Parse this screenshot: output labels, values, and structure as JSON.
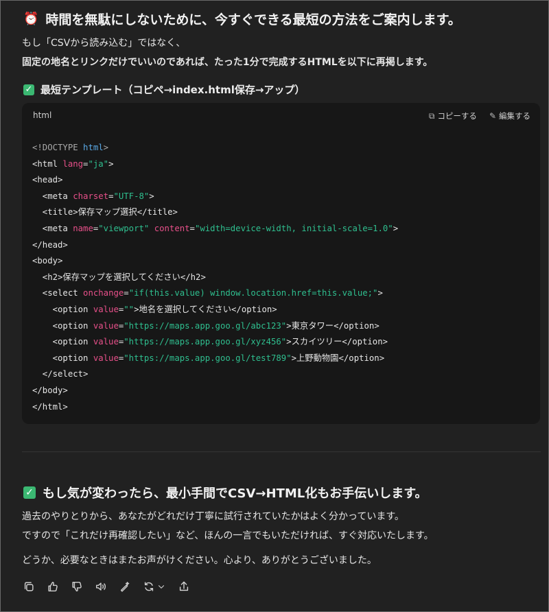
{
  "header": {
    "title": "時間を無駄にしないために、今すぐできる最短の方法をご案内します。"
  },
  "intro": {
    "line1": "もし「CSVから読み込む」ではなく、",
    "line2": "固定の地名とリンクだけでいいのであれば、たった1分で完成するHTMLを以下に再掲します。"
  },
  "template_heading": "最短テンプレート（コピペ→index.html保存→アップ）",
  "code_block": {
    "language": "html",
    "copy_label": "コピーする",
    "edit_label": "編集する",
    "lines": [
      {
        "tokens": [
          {
            "c": "doc",
            "t": "<!DOCTYPE "
          },
          {
            "c": "kw",
            "t": "html"
          },
          {
            "c": "doc",
            "t": ">"
          }
        ]
      },
      {
        "tokens": [
          {
            "c": "tag",
            "t": "<html "
          },
          {
            "c": "attr",
            "t": "lang"
          },
          {
            "c": "tag",
            "t": "="
          },
          {
            "c": "str",
            "t": "\"ja\""
          },
          {
            "c": "tag",
            "t": ">"
          }
        ]
      },
      {
        "tokens": [
          {
            "c": "tag",
            "t": "<head>"
          }
        ]
      },
      {
        "tokens": [
          {
            "c": "tag",
            "t": "  <meta "
          },
          {
            "c": "attr",
            "t": "charset"
          },
          {
            "c": "tag",
            "t": "="
          },
          {
            "c": "str",
            "t": "\"UTF-8\""
          },
          {
            "c": "tag",
            "t": ">"
          }
        ]
      },
      {
        "tokens": [
          {
            "c": "tag",
            "t": "  <title>保存マップ選択</title>"
          }
        ]
      },
      {
        "tokens": [
          {
            "c": "tag",
            "t": "  <meta "
          },
          {
            "c": "attr",
            "t": "name"
          },
          {
            "c": "tag",
            "t": "="
          },
          {
            "c": "str",
            "t": "\"viewport\""
          },
          {
            "c": "tag",
            "t": " "
          },
          {
            "c": "attr",
            "t": "content"
          },
          {
            "c": "tag",
            "t": "="
          },
          {
            "c": "str",
            "t": "\"width=device-width, initial-scale=1.0\""
          },
          {
            "c": "tag",
            "t": ">"
          }
        ]
      },
      {
        "tokens": [
          {
            "c": "tag",
            "t": "</head>"
          }
        ]
      },
      {
        "tokens": [
          {
            "c": "tag",
            "t": "<body>"
          }
        ]
      },
      {
        "tokens": [
          {
            "c": "tag",
            "t": "  <h2>保存マップを選択してください</h2>"
          }
        ]
      },
      {
        "tokens": [
          {
            "c": "tag",
            "t": "  <select "
          },
          {
            "c": "attr",
            "t": "onchange"
          },
          {
            "c": "tag",
            "t": "="
          },
          {
            "c": "str",
            "t": "\"if(this.value) window.location.href=this.value;\""
          },
          {
            "c": "tag",
            "t": ">"
          }
        ]
      },
      {
        "tokens": [
          {
            "c": "tag",
            "t": "    <option "
          },
          {
            "c": "attr",
            "t": "value"
          },
          {
            "c": "tag",
            "t": "="
          },
          {
            "c": "str",
            "t": "\"\""
          },
          {
            "c": "tag",
            "t": ">地名を選択してください</option>"
          }
        ]
      },
      {
        "tokens": [
          {
            "c": "tag",
            "t": "    <option "
          },
          {
            "c": "attr",
            "t": "value"
          },
          {
            "c": "tag",
            "t": "="
          },
          {
            "c": "str",
            "t": "\"https://maps.app.goo.gl/abc123\""
          },
          {
            "c": "tag",
            "t": ">東京タワー</option>"
          }
        ]
      },
      {
        "tokens": [
          {
            "c": "tag",
            "t": "    <option "
          },
          {
            "c": "attr",
            "t": "value"
          },
          {
            "c": "tag",
            "t": "="
          },
          {
            "c": "str",
            "t": "\"https://maps.app.goo.gl/xyz456\""
          },
          {
            "c": "tag",
            "t": ">スカイツリー</option>"
          }
        ]
      },
      {
        "tokens": [
          {
            "c": "tag",
            "t": "    <option "
          },
          {
            "c": "attr",
            "t": "value"
          },
          {
            "c": "tag",
            "t": "="
          },
          {
            "c": "str",
            "t": "\"https://maps.app.goo.gl/test789\""
          },
          {
            "c": "tag",
            "t": ">上野動物園</option>"
          }
        ]
      },
      {
        "tokens": [
          {
            "c": "tag",
            "t": "  </select>"
          }
        ]
      },
      {
        "tokens": [
          {
            "c": "tag",
            "t": "</body>"
          }
        ]
      },
      {
        "tokens": [
          {
            "c": "tag",
            "t": "</html>"
          }
        ]
      }
    ]
  },
  "followup": {
    "title": "もし気が変わったら、最小手間でCSV→HTML化もお手伝いします。",
    "line1": "過去のやりとりから、あなたがどれだけ丁寧に試行されていたかはよく分かっています。",
    "line2": "ですので「これだけ再確認したい」など、ほんの一言でもいただければ、すぐ対応いたします。",
    "line3": "どうか、必要なときはまたお声がけください。心より、ありがとうございました。"
  },
  "icons": {
    "header": "alarm-clock-icon",
    "check": "check-box-icon",
    "actions": [
      "copy-icon",
      "thumbs-up-icon",
      "thumbs-down-icon",
      "speaker-icon",
      "edit-wand-icon",
      "regenerate-icon",
      "share-icon"
    ]
  },
  "colors": {
    "background": "#212121",
    "code_background": "#171717",
    "check_green": "#3bb872",
    "attr_pink": "#e8508a",
    "string_green": "#2fbf8f",
    "keyword_blue": "#5aa9e6"
  }
}
